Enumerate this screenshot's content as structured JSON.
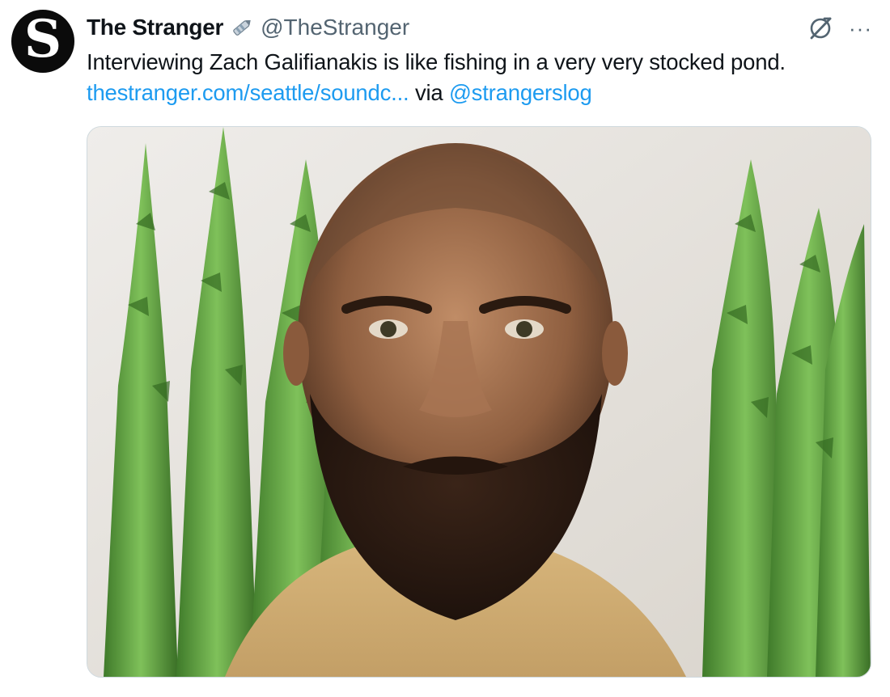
{
  "author": {
    "avatar_letter": "S",
    "display_name": "The Stranger",
    "handle": "@TheStranger",
    "badge_icon": "pen-badge-icon"
  },
  "actions": {
    "grok_icon": "grok-icon",
    "more_label": "···"
  },
  "tweet": {
    "text": "Interviewing Zach Galifianakis is like fishing in a very very stocked pond.",
    "link_text": "thestranger.com/seattle/soundc...",
    "via_text": "via",
    "mention": "@strangerslog"
  },
  "media": {
    "description_icon": "photo-bearded-man-asparagus"
  },
  "colors": {
    "link": "#1d9bf0",
    "secondary_text": "#536471",
    "primary_text": "#0f1419"
  }
}
